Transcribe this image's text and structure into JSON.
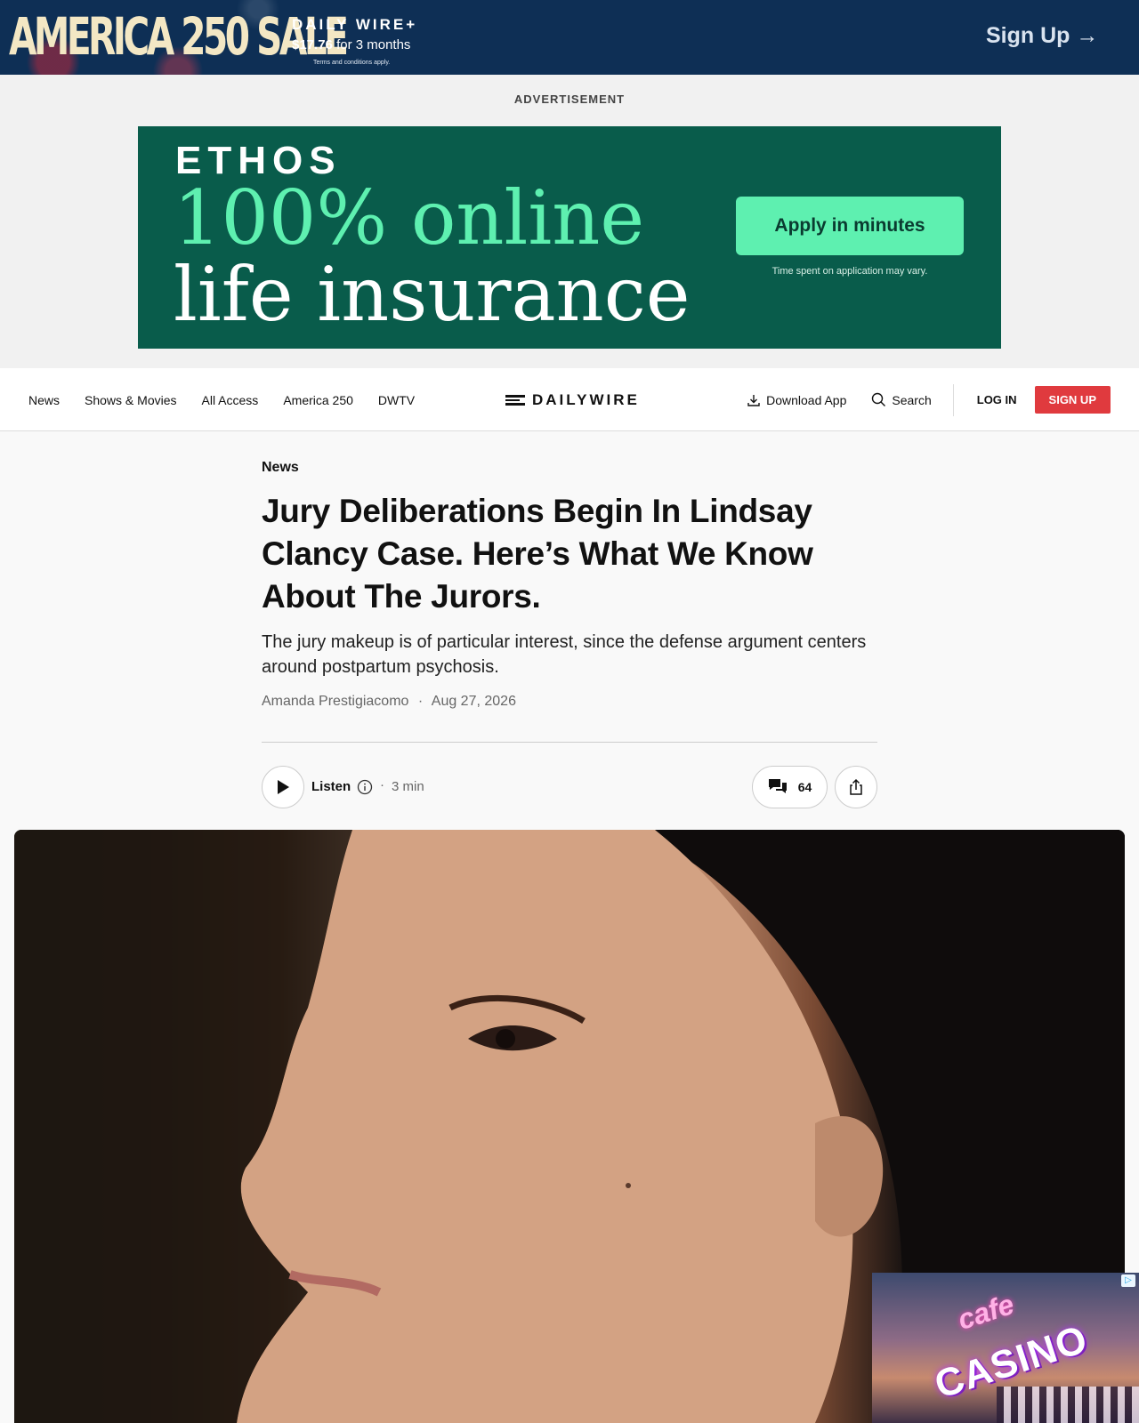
{
  "promo": {
    "sale_text": "AMERICA 250 SALE",
    "brand": "DAILY WIRE+",
    "price": "$17.76",
    "price_suffix": "for 3 months",
    "terms": "Terms and conditions apply.",
    "signup_label": "Sign Up →"
  },
  "ad": {
    "label": "ADVERTISEMENT",
    "logo": "ETHOS",
    "line1": "100% online",
    "line2": "life insurance",
    "cta": "Apply in minutes",
    "note": "Time spent on application may vary."
  },
  "nav": {
    "links": [
      "News",
      "Shows & Movies",
      "All Access",
      "America 250",
      "DWTV"
    ],
    "logo_text": "DAILYWIRE",
    "download_label": "Download App",
    "search_label": "Search",
    "login_label": "LOG IN",
    "signup_label": "SIGN UP"
  },
  "article": {
    "category": "News",
    "headline": "Jury Deliberations Begin In Lindsay Clancy Case. Here’s What We Know About The Jurors.",
    "dek": "The jury makeup is of particular interest, since the defense argument centers around postpartum psychosis.",
    "author": "Amanda Prestigiacomo",
    "separator": "·",
    "date": "Aug 27, 2026",
    "listen_label": "Listen",
    "duration": "3 min",
    "comment_count": "64"
  },
  "casino_ad": {
    "line1": "cafe",
    "line2": "CASINO",
    "adchoices": "▷"
  },
  "colors": {
    "promo_bg": "#0e2f55",
    "ethos_bg": "#095c4b",
    "ethos_accent": "#5ef0b0",
    "signup_red": "#e03a3e"
  },
  "icons": [
    "download-icon",
    "search-icon",
    "play-icon",
    "info-icon",
    "comments-icon",
    "share-icon"
  ]
}
